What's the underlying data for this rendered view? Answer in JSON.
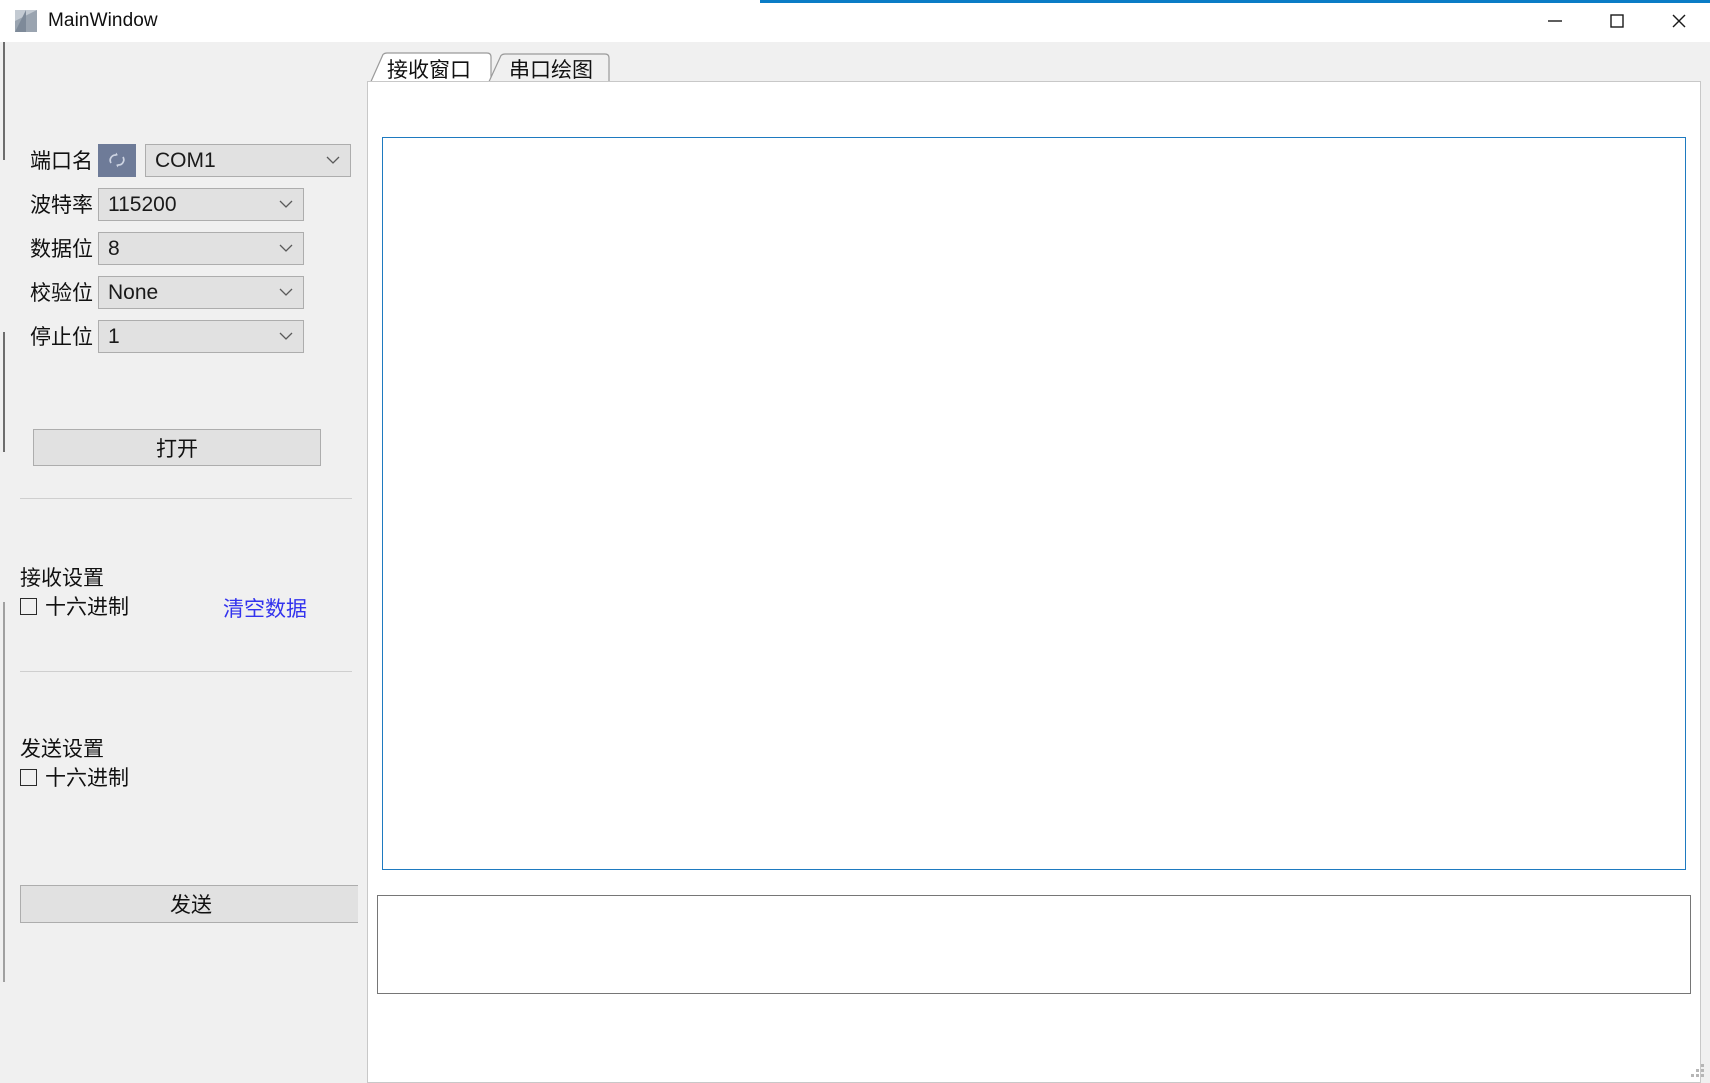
{
  "window": {
    "title": "MainWindow",
    "icon": "app-window-icon",
    "accent_color": "#0a7cc6",
    "controls": {
      "minimize": "minimize-icon",
      "maximize": "maximize-icon",
      "close": "close-icon"
    }
  },
  "left_panel": {
    "port": {
      "label": "端口名",
      "refresh_icon": "refresh-icon",
      "value": "COM1",
      "options": [
        "COM1"
      ]
    },
    "baud": {
      "label": "波特率",
      "value": "115200",
      "options": [
        "115200"
      ]
    },
    "data_bits": {
      "label": "数据位",
      "value": "8",
      "options": [
        "8"
      ]
    },
    "parity": {
      "label": "校验位",
      "value": "None",
      "options": [
        "None"
      ]
    },
    "stop_bits": {
      "label": "停止位",
      "value": "1",
      "options": [
        "1"
      ]
    },
    "open_button": "打开",
    "receive_settings": {
      "title": "接收设置",
      "hex_label": "十六进制",
      "hex_checked": false,
      "clear_link": "清空数据",
      "clear_link_color": "#3333ee"
    },
    "send_settings": {
      "title": "发送设置",
      "hex_label": "十六进制",
      "hex_checked": false
    },
    "send_button": "发送"
  },
  "right_panel": {
    "tabs": [
      {
        "label": "接收窗口",
        "active": true
      },
      {
        "label": "串口绘图",
        "active": false
      }
    ],
    "receive_textarea": {
      "value": "",
      "placeholder": "",
      "border_color": "#1e7ac0"
    },
    "send_textarea": {
      "value": "",
      "placeholder": "",
      "border_color": "#767676"
    }
  },
  "resize_grip": "resize-grip-icon"
}
